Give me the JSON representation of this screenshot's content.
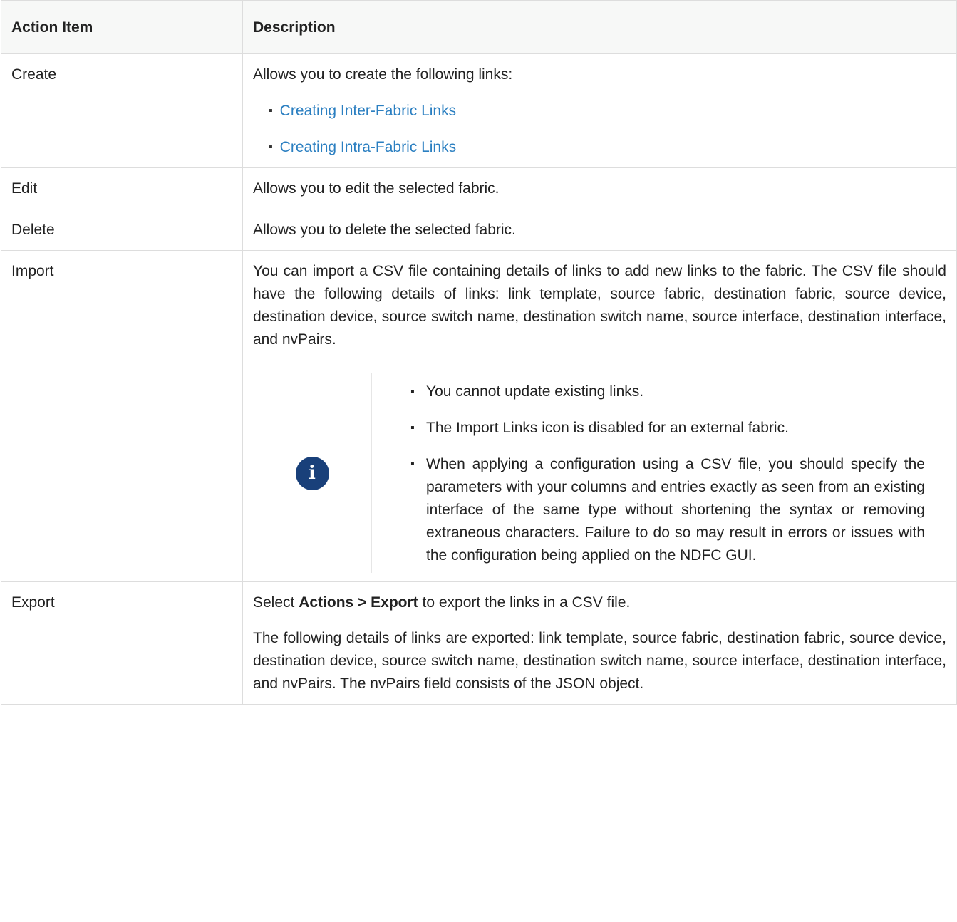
{
  "table": {
    "headers": [
      "Action Item",
      "Description"
    ],
    "create": {
      "action": "Create",
      "intro": "Allows you to create the following links:",
      "links": [
        "Creating Inter-Fabric Links",
        "Creating Intra-Fabric Links"
      ]
    },
    "edit": {
      "action": "Edit",
      "description": "Allows you to edit the selected fabric."
    },
    "delete": {
      "action": "Delete",
      "description": "Allows you to delete the selected fabric."
    },
    "import": {
      "action": "Import",
      "description": "You can import a CSV file containing details of links to add new links to the fabric. The CSV file should have the following details of links: link template, source fabric, destination fabric, source device, destination device, source switch name, destination switch name, source interface, destination interface, and nvPairs.",
      "note_icon": "info-icon",
      "note_items": [
        "You cannot update existing links.",
        "The Import Links icon is disabled for an external fabric.",
        "When applying a configuration using a CSV file, you should specify the parameters with your columns and entries exactly as seen from an existing interface of the same type without shortening the syntax or removing extraneous characters. Failure to do so may result in errors or issues with the configuration being applied on the NDFC GUI."
      ]
    },
    "export": {
      "action": "Export",
      "select_prefix": "Select",
      "select_bold": "Actions > Export",
      "select_suffix": "to export the links in a CSV file.",
      "details": "The following details of links are exported: link template, source fabric, destination fabric, source device, destination device, source switch name, destination switch name, source interface, destination interface, and nvPairs. The nvPairs field consists of the JSON object."
    }
  },
  "colors": {
    "link": "#2b7fc1",
    "info_icon_bg": "#19407a",
    "header_bg": "#f7f8f7",
    "border": "#dddddd"
  }
}
